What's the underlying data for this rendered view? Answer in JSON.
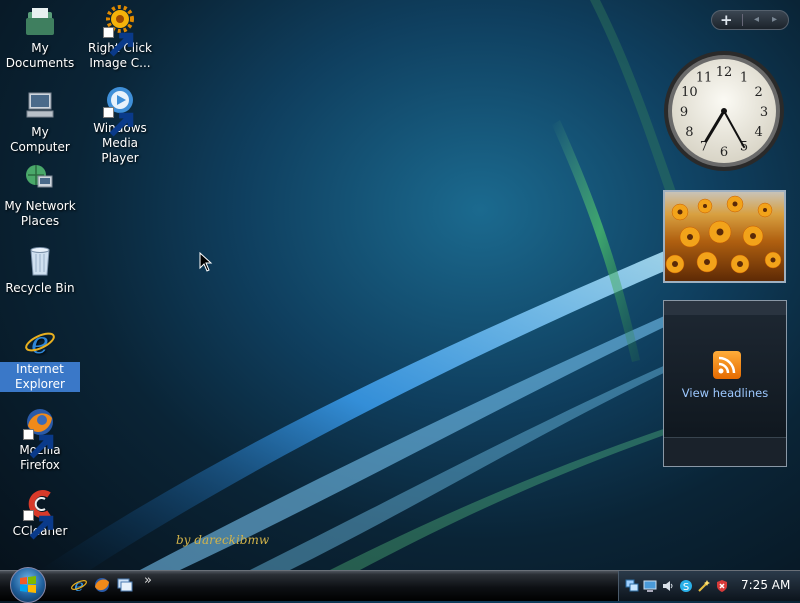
{
  "desktop": {
    "icons": [
      {
        "label": "My Documents"
      },
      {
        "label": "Right Click Image C..."
      },
      {
        "label": "My Computer"
      },
      {
        "label": "Windows Media Player"
      },
      {
        "label": "My Network Places"
      },
      {
        "label": "Recycle Bin"
      },
      {
        "label": "Internet Explorer",
        "selected": true
      },
      {
        "label": "Mozilla Firefox"
      },
      {
        "label": "CCleaner"
      }
    ],
    "signature": "by dareckibmw"
  },
  "sidebar": {
    "add_gadget": "+",
    "prev": "◂",
    "next": "▸",
    "clock_numerals": [
      "12",
      "1",
      "2",
      "3",
      "4",
      "5",
      "6",
      "7",
      "8",
      "9",
      "10",
      "11"
    ],
    "feed": {
      "label": "View headlines"
    }
  },
  "taskbar": {
    "more": "»",
    "time": "7:25 AM"
  },
  "colors": {
    "selection": "#3a78c8",
    "signature": "#d2b34a",
    "headline_text": "#9dc8ff"
  }
}
